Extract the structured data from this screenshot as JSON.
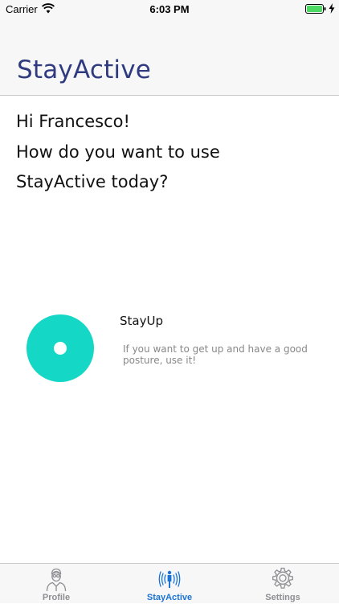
{
  "status_bar": {
    "carrier": "Carrier",
    "time": "6:03 PM",
    "icons": [
      "wifi-icon",
      "battery-icon",
      "charging-bolt-icon"
    ]
  },
  "nav": {
    "title": "StayActive"
  },
  "greeting": {
    "line1": "Hi Francesco!",
    "line2": "How do you want to use",
    "line3": "StayActive today?"
  },
  "options": [
    {
      "title": "StayUp",
      "description": "If you want to get up and have a good posture, use it!",
      "icon": "stayup-circle-icon",
      "color": "#14d8c5"
    }
  ],
  "tabs": [
    {
      "label": "Profile",
      "icon": "profile-icon",
      "active": false
    },
    {
      "label": "StayActive",
      "icon": "stayactive-icon",
      "active": true
    },
    {
      "label": "Settings",
      "icon": "settings-gear-icon",
      "active": false
    }
  ],
  "colors": {
    "title": "#2f3b7e",
    "accent": "#14d8c5",
    "tab_active": "#1a73d6",
    "tab_inactive": "#8e8e93"
  }
}
